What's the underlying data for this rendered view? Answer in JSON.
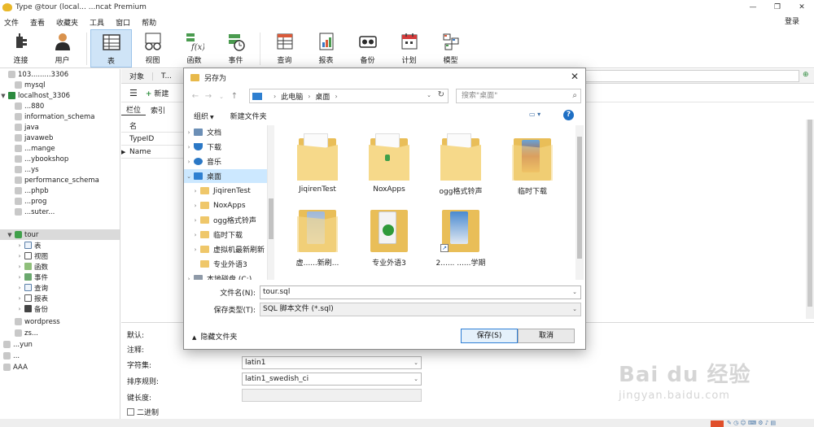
{
  "window": {
    "title": "Type @tour (local... ...ncat Premium",
    "controls": [
      "—",
      "❐",
      "✕"
    ]
  },
  "menu": {
    "items": [
      "文件",
      "查看",
      "收藏夹",
      "工具",
      "窗口",
      "帮助"
    ],
    "login": "登录"
  },
  "toolbar": {
    "buttons": [
      {
        "label": "连接",
        "icon": "plug-icon"
      },
      {
        "label": "用户",
        "icon": "user-icon"
      },
      {
        "label": "表",
        "icon": "table-icon"
      },
      {
        "label": "视图",
        "icon": "glasses-icon"
      },
      {
        "label": "函数",
        "icon": "function-icon"
      },
      {
        "label": "事件",
        "icon": "event-clock-icon"
      },
      {
        "label": "查询",
        "icon": "query-icon"
      },
      {
        "label": "报表",
        "icon": "report-icon"
      },
      {
        "label": "备份",
        "icon": "backup-icon"
      },
      {
        "label": "计划",
        "icon": "calendar-icon"
      },
      {
        "label": "模型",
        "icon": "model-icon"
      }
    ],
    "fn_glyph": "f(x)"
  },
  "sidebar": {
    "conn1": "103.........3306",
    "rows": [
      {
        "label": "mysql"
      },
      {
        "label": "localhost_3306"
      },
      {
        "label": "...880"
      },
      {
        "label": "information_schema"
      },
      {
        "label": "java"
      },
      {
        "label": "javaweb"
      },
      {
        "label": "...mange"
      },
      {
        "label": "...ybookshop"
      },
      {
        "label": "...ys"
      },
      {
        "label": "performance_schema"
      },
      {
        "label": "...phpb"
      },
      {
        "label": "...prog"
      },
      {
        "label": "...suter..."
      }
    ],
    "tour": "tour",
    "tour_children": [
      {
        "label": "表"
      },
      {
        "label": "视图"
      },
      {
        "label": "函数"
      },
      {
        "label": "事件"
      },
      {
        "label": "查询"
      },
      {
        "label": "报表"
      },
      {
        "label": "备份"
      }
    ],
    "after": [
      {
        "label": "wordpress"
      },
      {
        "label": "zs..."
      },
      {
        "label": "...yun"
      },
      {
        "label": "..."
      },
      {
        "label": "AAA"
      }
    ]
  },
  "object_tabs": {
    "objects": "对象",
    "editor": "T..."
  },
  "editor_bar": {
    "new_label": "新建"
  },
  "sub_tabs": [
    "栏位",
    "索引"
  ],
  "grid": {
    "header": "名",
    "rows": [
      "TypeID",
      "Name"
    ]
  },
  "props": {
    "default_label": "默认:",
    "comment_label": "注释:",
    "charset_label": "字符集:",
    "charset_value": "latin1",
    "collation_label": "排序规则:",
    "collation_value": "latin1_swedish_ci",
    "keylen_label": "键长度:",
    "binary_label": "二进制"
  },
  "watermark": {
    "main": "Bai du 经验",
    "sub": "jingyan.baidu.com"
  },
  "dialog": {
    "title": "另存为",
    "close": "✕",
    "path": [
      "此电脑",
      "桌面"
    ],
    "search_placeholder": "搜索\"桌面\"",
    "organize": "组织",
    "new_folder": "新建文件夹",
    "help": "?",
    "nav": [
      {
        "label": "文档",
        "icon": "documents-icon"
      },
      {
        "label": "下载",
        "icon": "download-icon"
      },
      {
        "label": "音乐",
        "icon": "music-icon"
      },
      {
        "label": "桌面",
        "icon": "desktop-icon"
      },
      {
        "label": "JiqirenTest",
        "icon": "folder-icon"
      },
      {
        "label": "NoxApps",
        "icon": "folder-icon"
      },
      {
        "label": "ogg格式铃声",
        "icon": "folder-icon"
      },
      {
        "label": "临时下载",
        "icon": "folder-icon"
      },
      {
        "label": "虚拟机最新刷新",
        "icon": "folder-icon"
      },
      {
        "label": "专业外语3",
        "icon": "folder-icon"
      },
      {
        "label": "本地磁盘 (C:)",
        "icon": "disk-icon"
      }
    ],
    "files": [
      {
        "name": "JiqirenTest"
      },
      {
        "name": "NoxApps"
      },
      {
        "name": "ogg格式铃声"
      },
      {
        "name": "临时下载"
      },
      {
        "name": "虚......新刷..."
      },
      {
        "name": "专业外语3"
      },
      {
        "name": "2...... ......学期"
      }
    ],
    "filename_label": "文件名(N):",
    "filename_value": "tour.sql",
    "filetype_label": "保存类型(T):",
    "filetype_value": "SQL 脚本文件 (*.sql)",
    "hide_folders": "隐藏文件夹",
    "save": "保存(S)",
    "cancel": "取消"
  }
}
